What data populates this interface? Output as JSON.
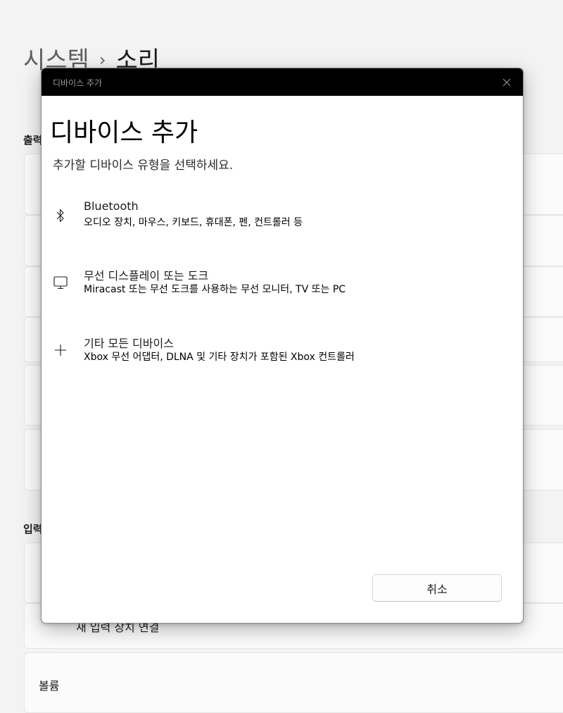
{
  "background": {
    "breadcrumb_parent": "시스템",
    "breadcrumb_sep": "›",
    "breadcrumb_current": "소리",
    "section_output": "출력",
    "section_input": "입력",
    "card_connect_input": "새 입력 장치 연결",
    "card_volume": "볼륨"
  },
  "dialog": {
    "titlebar_text": "디바이스 추가",
    "title": "디바이스 추가",
    "subtitle": "추가할 디바이스 유형을 선택하세요.",
    "options": [
      {
        "label": "Bluetooth",
        "desc": "오디오 장치, 마우스, 키보드, 휴대폰, 펜, 컨트롤러 등",
        "icon": "bluetooth-icon"
      },
      {
        "label": "무선 디스플레이 또는 도크",
        "desc": "Miracast 또는 무선 도크를 사용하는 무선 모니터, TV 또는 PC",
        "icon": "monitor-icon"
      },
      {
        "label": "기타 모든 디바이스",
        "desc": "Xbox 무선 어댑터, DLNA 및 기타 장치가 포함된 Xbox 컨트롤러",
        "icon": "plus-icon"
      }
    ],
    "cancel_label": "취소"
  }
}
